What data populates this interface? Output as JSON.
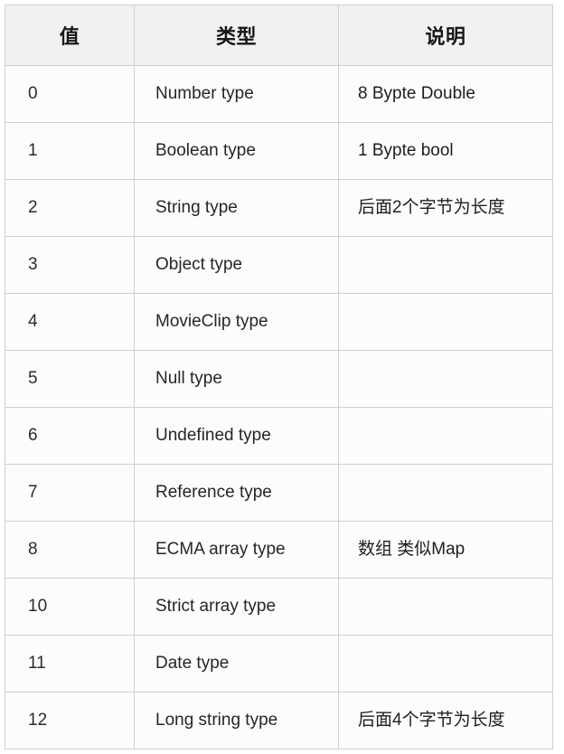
{
  "table": {
    "columns": [
      {
        "key": "value",
        "label": "值"
      },
      {
        "key": "type",
        "label": "类型"
      },
      {
        "key": "desc",
        "label": "说明"
      }
    ],
    "rows": [
      {
        "value": "0",
        "type": "Number type",
        "desc": "8 Bypte Double"
      },
      {
        "value": "1",
        "type": "Boolean type",
        "desc": "1 Bypte bool"
      },
      {
        "value": "2",
        "type": "String type",
        "desc": "后面2个字节为长度"
      },
      {
        "value": "3",
        "type": "Object type",
        "desc": ""
      },
      {
        "value": "4",
        "type": "MovieClip type",
        "desc": ""
      },
      {
        "value": "5",
        "type": "Null type",
        "desc": ""
      },
      {
        "value": "6",
        "type": "Undefined type",
        "desc": ""
      },
      {
        "value": "7",
        "type": "Reference type",
        "desc": ""
      },
      {
        "value": "8",
        "type": "ECMA array type",
        "desc": "数组 类似Map"
      },
      {
        "value": "10",
        "type": "Strict array type",
        "desc": ""
      },
      {
        "value": "11",
        "type": "Date type",
        "desc": ""
      },
      {
        "value": "12",
        "type": "Long string type",
        "desc": "后面4个字节为长度"
      }
    ]
  },
  "colors": {
    "header_background": "#f1f1f1",
    "cell_background": "#fcfcfc",
    "border": "#d0d0d0",
    "text": "#262626",
    "page_background": "#ffffff"
  }
}
